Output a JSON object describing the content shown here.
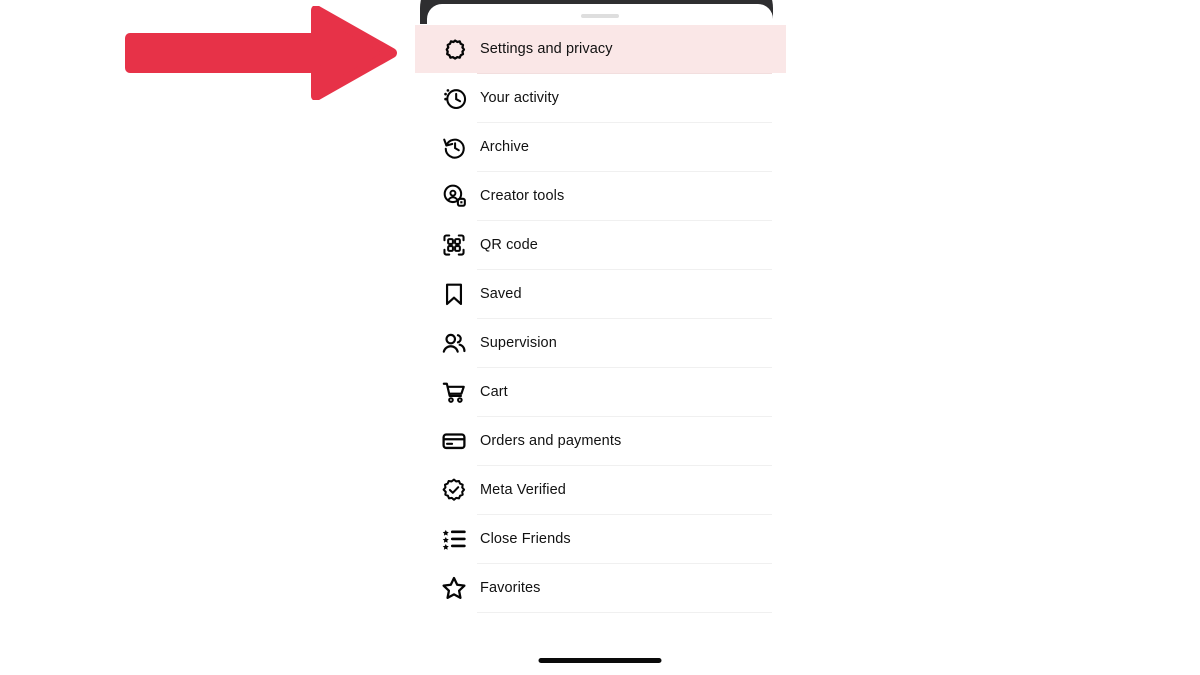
{
  "annotation": {
    "arrow": {
      "name": "red-pointer-arrow",
      "color": "#e73248",
      "direction": "right"
    }
  },
  "device": {
    "frame_color": "#2e2e30",
    "drag_handle_color": "#dedede",
    "home_indicator_color": "#0a0a0a"
  },
  "sheet": {
    "background": "#ffffff",
    "highlight_color": "#fae7e7",
    "divider_color": "#f0f0f0"
  },
  "menu": {
    "items": [
      {
        "label": "Settings and privacy",
        "icon": "settings-sunburst-icon",
        "highlighted": true
      },
      {
        "label": "Your activity",
        "icon": "activity-clock-icon",
        "highlighted": false
      },
      {
        "label": "Archive",
        "icon": "archive-clock-rewind-icon",
        "highlighted": false
      },
      {
        "label": "Creator tools",
        "icon": "creator-tools-icon",
        "highlighted": false
      },
      {
        "label": "QR code",
        "icon": "qr-code-icon",
        "highlighted": false
      },
      {
        "label": "Saved",
        "icon": "bookmark-icon",
        "highlighted": false
      },
      {
        "label": "Supervision",
        "icon": "supervision-people-icon",
        "highlighted": false
      },
      {
        "label": "Cart",
        "icon": "shopping-cart-icon",
        "highlighted": false
      },
      {
        "label": "Orders and payments",
        "icon": "credit-card-icon",
        "highlighted": false
      },
      {
        "label": "Meta Verified",
        "icon": "verified-badge-icon",
        "highlighted": false
      },
      {
        "label": "Close Friends",
        "icon": "star-list-icon",
        "highlighted": false
      },
      {
        "label": "Favorites",
        "icon": "star-outline-icon",
        "highlighted": false
      }
    ]
  }
}
